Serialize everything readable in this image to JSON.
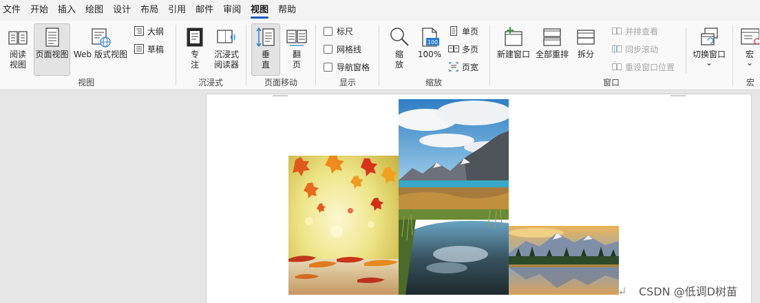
{
  "menu": [
    "文件",
    "开始",
    "插入",
    "绘图",
    "设计",
    "布局",
    "引用",
    "邮件",
    "审阅",
    "视图",
    "帮助"
  ],
  "active_menu": "视图",
  "groups": {
    "views": {
      "label": "视图",
      "read_mode": "阅读\n视图",
      "print_layout": "页面视图",
      "web_layout": "Web 版式视图",
      "outline": "大纲",
      "draft": "草稿"
    },
    "immersive": {
      "label": "沉浸式",
      "focus": "专\n注",
      "immersive_reader": "沉浸式\n阅读器"
    },
    "page_movement": {
      "label": "页面移动",
      "vertical": "垂\n直",
      "side_to_side": "翻\n页"
    },
    "show": {
      "label": "显示",
      "ruler": "标尺",
      "gridlines": "网格线",
      "nav_pane": "导航窗格"
    },
    "zoom": {
      "label": "缩放",
      "zoom": "缩\n放",
      "hundred": "100%",
      "hundred_icon": "100",
      "one_page": "单页",
      "multi_page": "多页",
      "page_width": "页宽"
    },
    "window": {
      "label": "窗口",
      "new_window": "新建窗口",
      "arrange_all": "全部重排",
      "split": "拆分",
      "side_by_side": "并排查看",
      "sync_scroll": "同步滚动",
      "reset_position": "重设窗口位置",
      "switch_windows": "切换窗口",
      "switch_caret": "⌄"
    },
    "macros": {
      "label": "宏",
      "macros": "宏",
      "caret": "⌄"
    }
  },
  "watermark": "CSDN @低调D树苗",
  "accent_color": "#185abd"
}
